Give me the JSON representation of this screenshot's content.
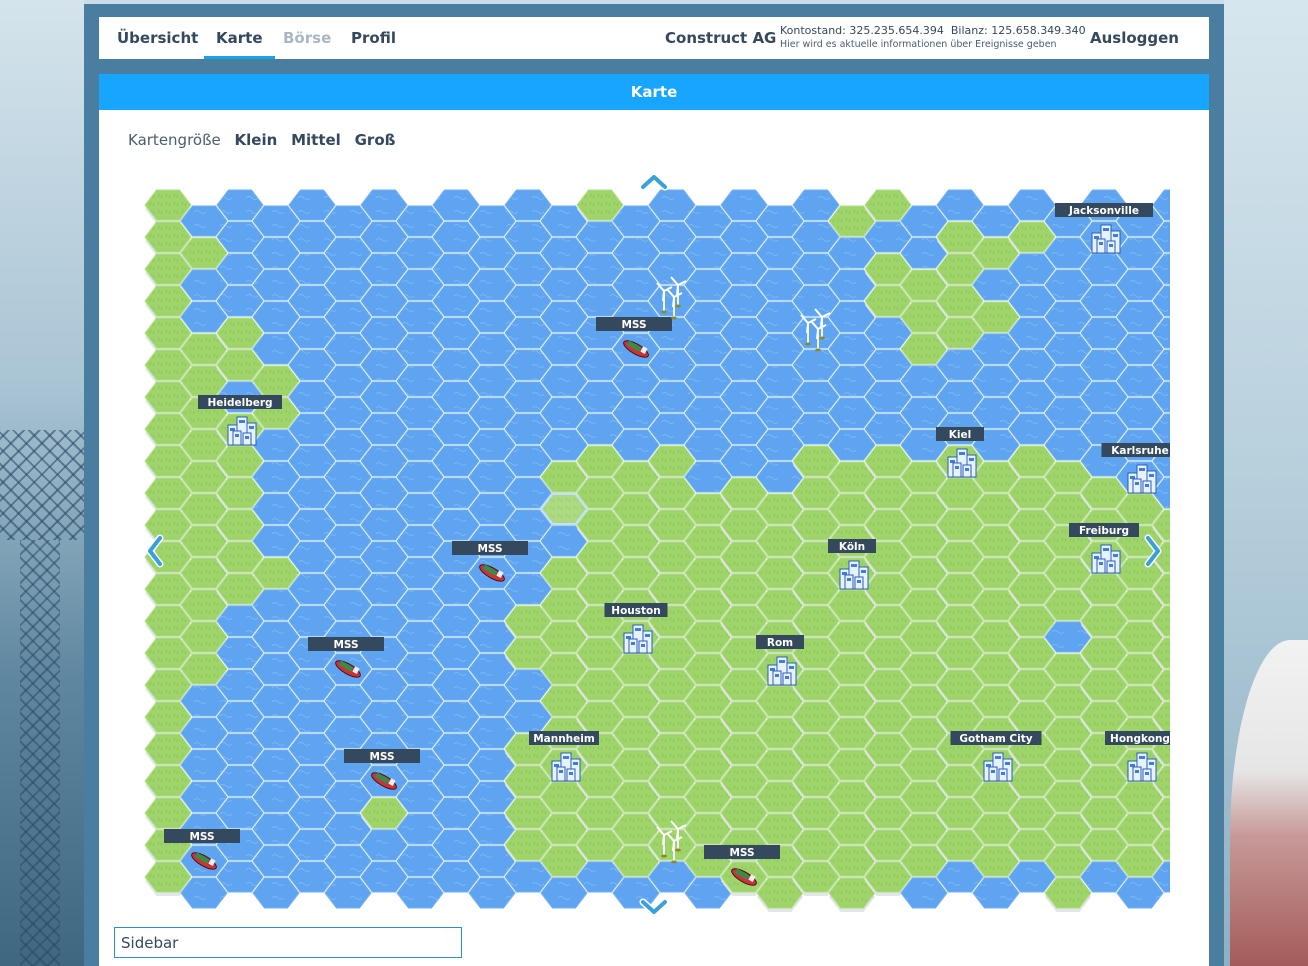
{
  "nav": {
    "tabs": [
      {
        "label": "Übersicht"
      },
      {
        "label": "Karte"
      },
      {
        "label": "Börse"
      },
      {
        "label": "Profil"
      }
    ],
    "company": "Construct AG",
    "kontostand_label": "Kontostand:",
    "kontostand": "325.235.654.394",
    "bilanz_label": "Bilanz:",
    "bilanz": "125.658.349.340",
    "info": "Hier wird es aktuelle informationen über Ereignisse geben",
    "logout": "Ausloggen"
  },
  "panel": {
    "title": "Karte",
    "size_label": "Kartengröße",
    "size_small": "Klein",
    "size_medium": "Mittel",
    "size_large": "Groß"
  },
  "sidebar": {
    "label": "Sidebar"
  },
  "colors": {
    "water": "#5fa4f0",
    "land": "#9fd46b",
    "label_bg": "#34495e",
    "header": "#17a5ff"
  },
  "map": {
    "land": [
      "L...........L......LL",
      "LL....................LLL",
      "L...................LLL.",
      "L...................LLLL",
      "LLL..................LL.",
      "LLLL...................",
      "LL.L......................",
      "LLL.........................",
      "LLL........LLLL...LLLLLLLL.....",
      "LLL........LLLLLLLLLLLLLLLLL...",
      "LLL.........LLLLLLLLLLLLLLLLLL.",
      "LLLL.......LLLLLLLLLLLLLLLLLLLL",
      "LLL........LLLLLLLLLLLLLLLLLLLL",
      "LL........LLLLLLLLLLLLLLL.LLLLL",
      "LL........LLLLLLLLLLLLLLLLLLLLL",
      "L..........LLLLLLLLLLLLLLLLLLLL",
      "L..........LLLLLLLLLLLLLLLLLLLL",
      "L.........LLLLLLLLLLLLLLLLLLLLLL",
      "L.........LLLLLLLLLLLLLLLLLLLLLL",
      "L.....L...LLLLLLLLLLLLLLLLLLLL.L",
      "L.........LLLLLLLLLLLLLLLLLLL...",
      "L...............LLLLL....L.....L",
      "LL..............L........L...LL.",
      "LL..........................LLLL",
      "LL...........................LLL"
    ],
    "cities": [
      {
        "name": "Jacksonville",
        "col": 26,
        "row": 1
      },
      {
        "name": "Heidelberg",
        "col": 2,
        "row": 7
      },
      {
        "name": "Kiel",
        "col": 22,
        "row": 8
      },
      {
        "name": "Karlsruhe",
        "col": 27,
        "row": 8
      },
      {
        "name": "Freiburg",
        "col": 26,
        "row": 11
      },
      {
        "name": "Köln",
        "col": 19,
        "row": 11
      },
      {
        "name": "Houston",
        "col": 13,
        "row": 13
      },
      {
        "name": "Rom",
        "col": 17,
        "row": 14
      },
      {
        "name": "Mannheim",
        "col": 11,
        "row": 17
      },
      {
        "name": "Gotham City",
        "col": 23,
        "row": 17
      },
      {
        "name": "Hongkong",
        "col": 27,
        "row": 17
      }
    ],
    "ships": [
      {
        "name": "MSS",
        "col": 13,
        "row": 4
      },
      {
        "name": "MSS",
        "col": 9,
        "row": 11
      },
      {
        "name": "MSS",
        "col": 5,
        "row": 14
      },
      {
        "name": "MSS",
        "col": 6,
        "row": 18
      },
      {
        "name": "MSS",
        "col": 1,
        "row": 20
      },
      {
        "name": "MSS",
        "col": 16,
        "row": 21
      }
    ],
    "windparks": [
      {
        "col": 14,
        "row": 3
      },
      {
        "col": 18,
        "row": 4
      },
      {
        "col": 14,
        "row": 20
      }
    ],
    "selected_hex": {
      "col": 11,
      "row": 9
    }
  }
}
